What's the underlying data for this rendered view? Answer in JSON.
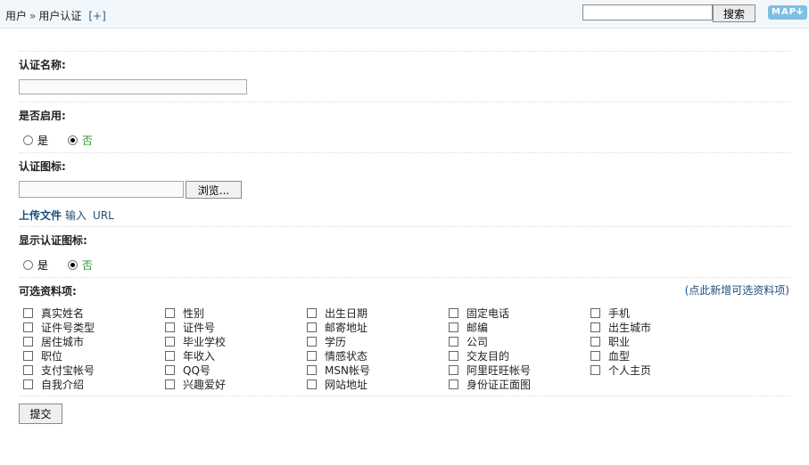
{
  "breadcrumb": {
    "root": "用户",
    "separator": "»",
    "current": "用户认证",
    "add": "[+]"
  },
  "search": {
    "value": "",
    "button": "搜索"
  },
  "map_button": {
    "label": "MAP",
    "arrow": "🡫"
  },
  "form": {
    "name_label": "认证名称:",
    "name_value": "",
    "enabled_label": "是否启用:",
    "enabled_options": [
      "是",
      "否"
    ],
    "icon_label": "认证图标:",
    "browse_button": "浏览...",
    "upload_modes": [
      "上传文件",
      "输入",
      "URL"
    ],
    "show_icon_label": "显示认证图标:",
    "show_icon_options": [
      "是",
      "否"
    ],
    "optional_fields_label": "可选资料项:",
    "add_optional_link": "(点此新增可选资料项)",
    "optional_fields": [
      [
        "真实姓名",
        "性别",
        "出生日期",
        "固定电话",
        "手机"
      ],
      [
        "证件号类型",
        "证件号",
        "邮寄地址",
        "邮编",
        "出生城市"
      ],
      [
        "居住城市",
        "毕业学校",
        "学历",
        "公司",
        "职业"
      ],
      [
        "职位",
        "年收入",
        "情感状态",
        "交友目的",
        "血型"
      ],
      [
        "支付宝帐号",
        "QQ号",
        "MSN帐号",
        "阿里旺旺帐号",
        "个人主页"
      ],
      [
        "自我介绍",
        "兴趣爱好",
        "网站地址",
        "身份证正面图"
      ]
    ],
    "submit_button": "提交"
  }
}
